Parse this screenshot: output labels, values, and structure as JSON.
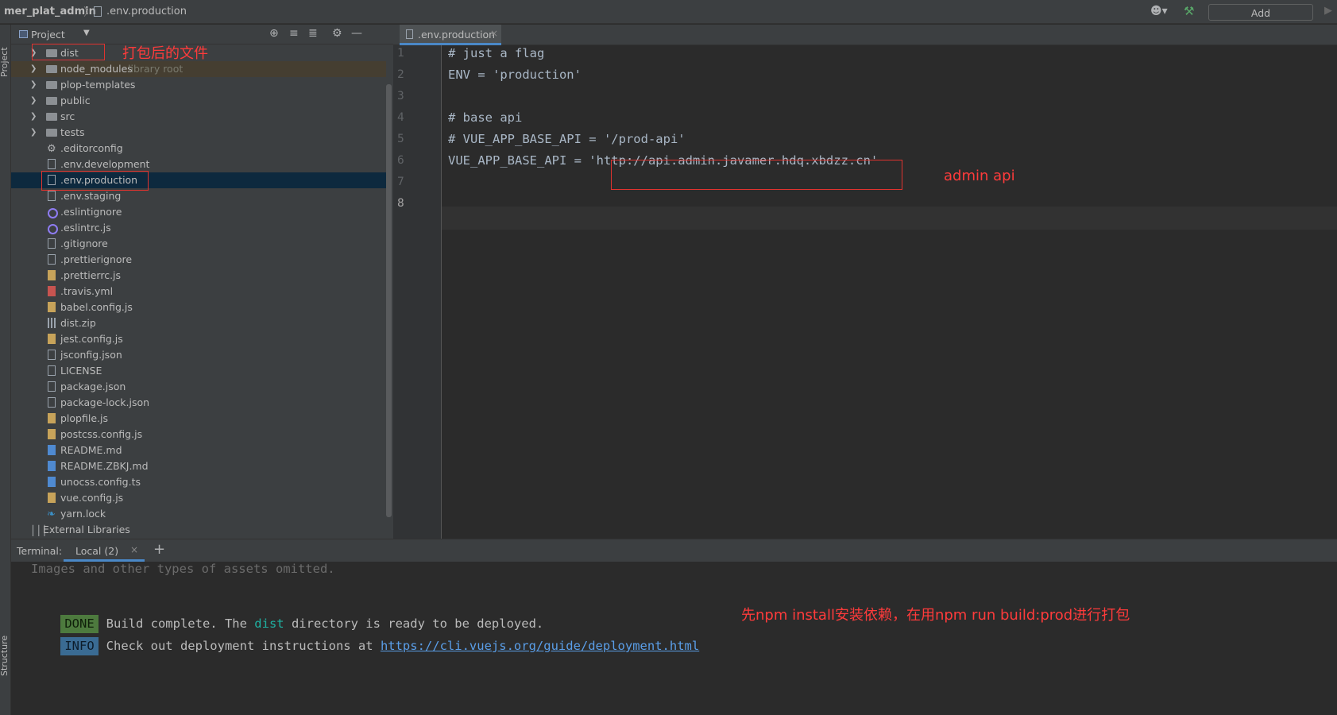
{
  "navbar": {
    "project": "mer_plat_admin",
    "separator": "〉",
    "file": ".env.production",
    "add_configuration": "Add Configuration..."
  },
  "left_stripe": {
    "project_label": "Project",
    "structure_label": "Structure"
  },
  "project_panel": {
    "title": "Project",
    "items": [
      {
        "label": "dist",
        "type": "folder",
        "expandable": true
      },
      {
        "label": "node_modules",
        "hint": "library root",
        "type": "folder",
        "expandable": true
      },
      {
        "label": "plop-templates",
        "type": "folder",
        "expandable": true
      },
      {
        "label": "public",
        "type": "folder",
        "expandable": true
      },
      {
        "label": "src",
        "type": "folder",
        "expandable": true
      },
      {
        "label": "tests",
        "type": "folder",
        "expandable": true
      },
      {
        "label": ".editorconfig",
        "type": "gear"
      },
      {
        "label": ".env.development",
        "type": "file"
      },
      {
        "label": ".env.production",
        "type": "file",
        "selected": true
      },
      {
        "label": ".env.staging",
        "type": "file"
      },
      {
        "label": ".eslintignore",
        "type": "ring"
      },
      {
        "label": ".eslintrc.js",
        "type": "ring"
      },
      {
        "label": ".gitignore",
        "type": "file"
      },
      {
        "label": ".prettierignore",
        "type": "file"
      },
      {
        "label": ".prettierrc.js",
        "type": "js"
      },
      {
        "label": ".travis.yml",
        "type": "yml"
      },
      {
        "label": "babel.config.js",
        "type": "js"
      },
      {
        "label": "dist.zip",
        "type": "zip"
      },
      {
        "label": "jest.config.js",
        "type": "js"
      },
      {
        "label": "jsconfig.json",
        "type": "file"
      },
      {
        "label": "LICENSE",
        "type": "file"
      },
      {
        "label": "package.json",
        "type": "file"
      },
      {
        "label": "package-lock.json",
        "type": "file"
      },
      {
        "label": "plopfile.js",
        "type": "js"
      },
      {
        "label": "postcss.config.js",
        "type": "js"
      },
      {
        "label": "README.md",
        "type": "md"
      },
      {
        "label": "README.ZBKJ.md",
        "type": "md"
      },
      {
        "label": "unocss.config.ts",
        "type": "md"
      },
      {
        "label": "vue.config.js",
        "type": "js"
      },
      {
        "label": "yarn.lock",
        "type": "yarn"
      },
      {
        "label": "External Libraries",
        "type": "bars"
      }
    ]
  },
  "editor": {
    "tab": ".env.production",
    "current_line": 8,
    "lines": [
      "# just a flag",
      "ENV = 'production'",
      "",
      "# base api",
      "# VUE_APP_BASE_API = '/prod-api'",
      "VUE_APP_BASE_API = 'http://api.admin.javamer.hdq.xbdzz.cn'",
      "",
      ""
    ]
  },
  "terminal": {
    "label": "Terminal:",
    "tab": "Local (2)",
    "omitted": "Images and other types of assets omitted.",
    "done_badge": "DONE",
    "done_pre": "Build complete. The ",
    "done_dist": "dist",
    "done_post": " directory is ready to be deployed.",
    "info_badge": "INFO",
    "info_text": "Check out deployment instructions at ",
    "info_link": "https://cli.vuejs.org/guide/deployment.html"
  },
  "annotations": {
    "dist_note": "打包后的文件",
    "api_note": "admin api",
    "build_note": "先npm install安装依赖，在用npm run build:prod进行打包"
  },
  "colors": {
    "annotation": "#ff3b3b",
    "selection": "#0d293e",
    "accent": "#4a88c7"
  }
}
